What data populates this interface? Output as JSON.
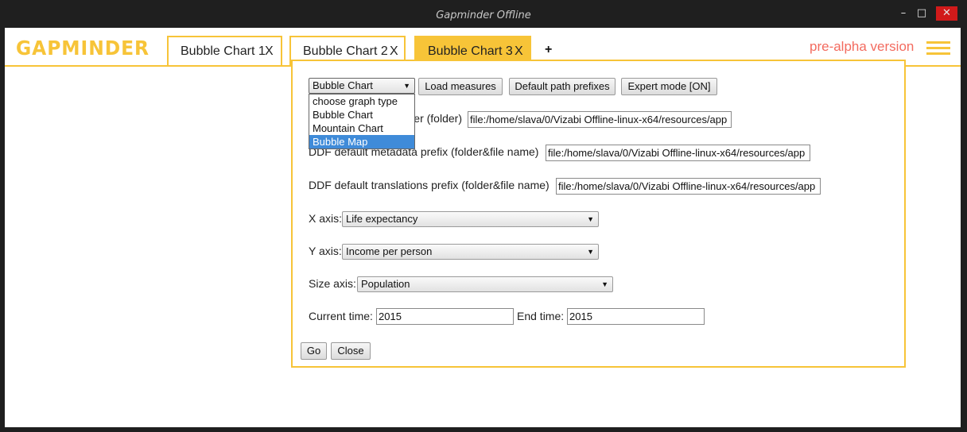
{
  "window": {
    "title": "Gapminder Offline",
    "minimize": "–",
    "maximize": "□",
    "close": "✕"
  },
  "app": {
    "logo_text": "GAPMINDER",
    "version_label": "pre-alpha version",
    "menu_icon": "hamburger-icon",
    "accent_color": "#f7c438",
    "version_color": "#f36b5f"
  },
  "tabs": [
    {
      "label": "Bubble Chart 1",
      "close": "X",
      "active": false
    },
    {
      "label": "Bubble Chart 2",
      "close": "X",
      "active": false
    },
    {
      "label": "Bubble Chart 3",
      "close": "X",
      "active": true
    }
  ],
  "add_tab": "+",
  "dialog": {
    "graph_type_selected": "Bubble Chart",
    "graph_type_options": [
      "choose graph type",
      "Bubble Chart",
      "Mountain Chart",
      "Bubble Map"
    ],
    "graph_type_highlighted": "Bubble Map",
    "load_measures": "Load measures",
    "default_path_prefixes": "Default path prefixes",
    "expert_mode": "Expert mode [ON]",
    "ddf_folder_label": "DDF default data folder (folder)",
    "ddf_folder_value": "file:/home/slava/0/Vizabi Offline-linux-x64/resources/app",
    "ddf_metadata_label": "DDF default metadata prefix (folder&file name)",
    "ddf_metadata_value": "file:/home/slava/0/Vizabi Offline-linux-x64/resources/app",
    "ddf_translations_label": "DDF default translations prefix (folder&file name)",
    "ddf_translations_value": "file:/home/slava/0/Vizabi Offline-linux-x64/resources/app",
    "x_axis_label": "X axis:",
    "x_axis_value": "Life expectancy",
    "y_axis_label": "Y axis:",
    "y_axis_value": "Income per person",
    "size_axis_label": "Size axis:",
    "size_axis_value": "Population",
    "current_time_label": "Current time:",
    "current_time_value": "2015",
    "end_time_label": "End time:",
    "end_time_value": "2015",
    "go": "Go",
    "close": "Close"
  }
}
